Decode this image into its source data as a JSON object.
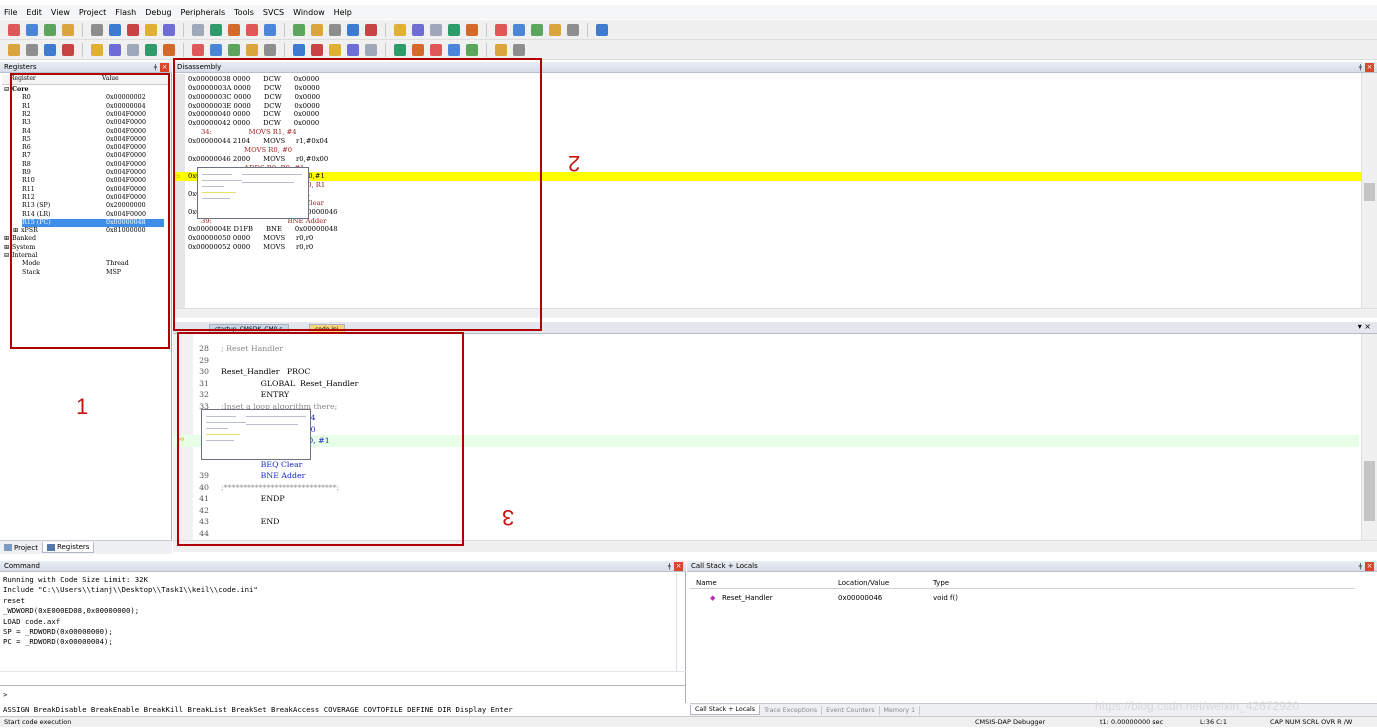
{
  "menu": [
    "File",
    "Edit",
    "View",
    "Project",
    "Flash",
    "Debug",
    "Peripherals",
    "Tools",
    "SVCS",
    "Window",
    "Help"
  ],
  "toolbar_colors": [
    "#e05757",
    "#4b86d8",
    "#5ca55c",
    "#d9a53c",
    "#8e8e8e",
    "#3c7bd0",
    "#c84444",
    "#e0b030",
    "#6d6dd5",
    "#9fa8b8",
    "#2e9b6b",
    "#d36a2a"
  ],
  "registers": {
    "title": "Registers",
    "col_register": "Register",
    "col_value": "Value",
    "rows": [
      {
        "name": "Core",
        "value": "",
        "level": 0,
        "bold": true,
        "toggle": "⊟"
      },
      {
        "name": "R0",
        "value": "0x00000002",
        "level": 2
      },
      {
        "name": "R1",
        "value": "0x00000004",
        "level": 2
      },
      {
        "name": "R2",
        "value": "0x004F0000",
        "level": 2
      },
      {
        "name": "R3",
        "value": "0x004F0000",
        "level": 2
      },
      {
        "name": "R4",
        "value": "0x004F0000",
        "level": 2
      },
      {
        "name": "R5",
        "value": "0x004F0000",
        "level": 2
      },
      {
        "name": "R6",
        "value": "0x004F0000",
        "level": 2
      },
      {
        "name": "R7",
        "value": "0x004F0000",
        "level": 2
      },
      {
        "name": "R8",
        "value": "0x004F0000",
        "level": 2
      },
      {
        "name": "R9",
        "value": "0x004F0000",
        "level": 2
      },
      {
        "name": "R10",
        "value": "0x004F0000",
        "level": 2
      },
      {
        "name": "R11",
        "value": "0x004F0000",
        "level": 2
      },
      {
        "name": "R12",
        "value": "0x004F0000",
        "level": 2
      },
      {
        "name": "R13 (SP)",
        "value": "0x20000000",
        "level": 2
      },
      {
        "name": "R14 (LR)",
        "value": "0x004F0000",
        "level": 2
      },
      {
        "name": "R15 (PC)",
        "value": "0x00000048",
        "level": 2,
        "selected": true
      },
      {
        "name": "xPSR",
        "value": "0x81000000",
        "level": 1,
        "toggle": "⊞"
      },
      {
        "name": "Banked",
        "value": "",
        "level": 0,
        "toggle": "⊞"
      },
      {
        "name": "System",
        "value": "",
        "level": 0,
        "toggle": "⊞"
      },
      {
        "name": "Internal",
        "value": "",
        "level": 0,
        "toggle": "⊟"
      },
      {
        "name": "Mode",
        "value": "Thread",
        "level": 2
      },
      {
        "name": "Stack",
        "value": "MSP",
        "level": 2
      }
    ],
    "tabs": [
      "Project",
      "Registers"
    ]
  },
  "disassembly": {
    "title": "Disassembly",
    "lines": [
      {
        "t": "0x00000038 0000      DCW      0x0000"
      },
      {
        "t": "0x0000003A 0000      DCW      0x0000"
      },
      {
        "t": "0x0000003C 0000      DCW      0x0000"
      },
      {
        "t": "0x0000003E 0000      DCW      0x0000"
      },
      {
        "t": "0x00000040 0000      DCW      0x0000"
      },
      {
        "t": "0x00000042 0000      DCW      0x0000"
      },
      {
        "t": "      34:                 MOVS R1, #4",
        "src": true
      },
      {
        "t": "0x00000044 2104      MOVS     r1,#0x04"
      },
      {
        "t": "                          MOVS R0, #0",
        "src": true
      },
      {
        "t": "0x00000046 2000      MOVS     r0,#0x00"
      },
      {
        "t": "                          ADDS R0, R0, #1",
        "src": true
      },
      {
        "t": "0x00000048 1C40      ADDS     r0,r0,#1",
        "current": true
      },
      {
        "t": "                                            CMP R0, R1",
        "src": true
      },
      {
        "t": "0x0000004A 4288      CMP      r0,r1"
      },
      {
        "t": "      38:                                   BEQ Clear",
        "src": true
      },
      {
        "t": "0x0000004C D0FB      BEQ      0x00000046"
      },
      {
        "t": "      39:                                   BNE Adder",
        "src": true
      },
      {
        "t": "0x0000004E D1FB      BNE      0x00000048"
      },
      {
        "t": "0x00000050 0000      MOVS     r0,r0"
      },
      {
        "t": "0x00000052 0000      MOVS     r0,r0"
      }
    ]
  },
  "editor": {
    "tabs": [
      "startup_CMSDK_CM0.s",
      "code.ini"
    ],
    "lines": [
      {
        "n": "28",
        "t": "; Reset Handler",
        "cls": "cm"
      },
      {
        "n": "29",
        "t": ""
      },
      {
        "n": "30",
        "t": "Reset_Handler   PROC"
      },
      {
        "n": "31",
        "t": "                GLOBAL  Reset_Handler"
      },
      {
        "n": "32",
        "t": "                ENTRY"
      },
      {
        "n": "33",
        "t": ";Inset a loop algorithm there;",
        "cls": "cm"
      },
      {
        "n": "",
        "t": "                MOVS R1, #4",
        "cls": "kw"
      },
      {
        "n": "",
        "t": "                MOVS R0, #0",
        "cls": "kw"
      },
      {
        "n": "",
        "t": "                ADDS R0, R0, #1",
        "cls": "kw",
        "current": true
      },
      {
        "n": "",
        "t": "                CMP R0, R1",
        "cls": "kw"
      },
      {
        "n": "",
        "t": "                BEQ Clear",
        "cls": "kw"
      },
      {
        "n": "39",
        "t": "                BNE Adder",
        "cls": "kw"
      },
      {
        "n": "40",
        "t": ";*****************************;",
        "cls": "cm"
      },
      {
        "n": "41",
        "t": "                ENDP"
      },
      {
        "n": "42",
        "t": ""
      },
      {
        "n": "43",
        "t": "                END"
      },
      {
        "n": "44",
        "t": ""
      }
    ]
  },
  "annotations": [
    "1",
    "2",
    "3"
  ],
  "command": {
    "title": "Command",
    "lines": [
      "Running with Code Size Limit: 32K",
      "Include \"C:\\\\Users\\\\tianj\\\\Desktop\\\\Task1\\\\keil\\\\code.ini\"",
      "reset",
      "_WDWORD(0xE000ED08,0x00000000);",
      "LOAD code.axf",
      "SP = _RDWORD(0x00000000);",
      "PC = _RDWORD(0x00000004);"
    ],
    "prompt": ">",
    "hint": "ASSIGN BreakDisable BreakEnable BreakKill BreakList BreakSet BreakAccess COVERAGE COVTOFILE DEFINE DIR Display Enter"
  },
  "callstack": {
    "title": "Call Stack + Locals",
    "col_name": "Name",
    "col_loc": "Location/Value",
    "col_type": "Type",
    "row": {
      "name": "Reset_Handler",
      "loc": "0x00000046",
      "type": "void f()"
    },
    "tabs": [
      "Call Stack + Locals",
      "Trace Exceptions",
      "Event Counters",
      "Memory 1"
    ]
  },
  "status": {
    "left": "Start code execution",
    "debugger": "CMSIS-DAP Debugger",
    "time": "t1: 0.00000000 sec",
    "pos": "L:36 C:1",
    "keys": "CAP  NUM  SCRL  OVR  R /W"
  },
  "watermark": "https://blog.csdn.net/weixin_42672920"
}
